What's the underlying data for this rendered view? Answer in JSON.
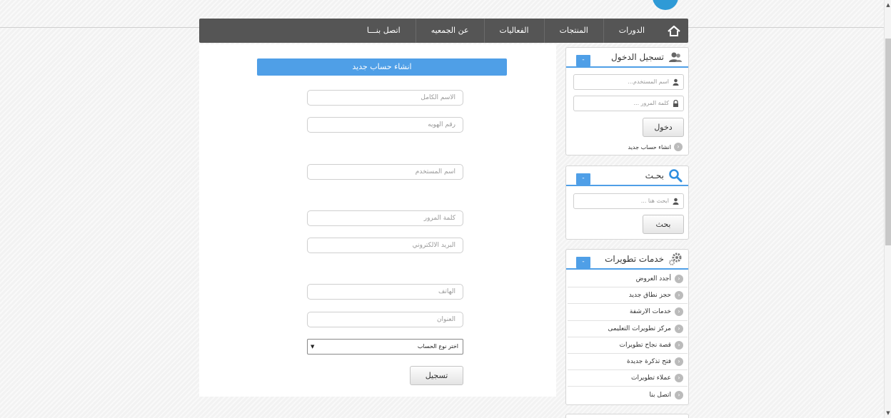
{
  "nav": {
    "items": [
      "الدورات",
      "المنتجات",
      "الفعاليات",
      "عن الجمعيه",
      "اتصل بنـــا"
    ]
  },
  "registration": {
    "title": "انشاء حساب جديد",
    "fields": {
      "full_name": "الاسم الكامل",
      "id_number": "رقم الهويه",
      "username": "اسم المستخدم",
      "password": "كلمة المرور",
      "email": "البريد الالكتروني",
      "phone": "الهاتف",
      "address": "العنوان"
    },
    "account_type": "اختر نوع الحساب",
    "submit_label": "تسجيل"
  },
  "login_panel": {
    "title": "تسجيل الدخول",
    "collapse_label": "-",
    "username_placeholder": "اسم المستخدم...",
    "password_placeholder": "كلمة المرور ...",
    "login_button": "دخول",
    "create_account_link": "انشاء حساب جديد"
  },
  "search_panel": {
    "title": "بحـث",
    "collapse_label": "-",
    "search_placeholder": "ابحث هنا ...",
    "search_button": "بحث"
  },
  "services_panel": {
    "title": "خدمات تطويرات",
    "collapse_label": "-",
    "items": [
      "أجدد العروض",
      "حجز نطاق جديد",
      "خدمات الارشفة",
      "مركز تطويرات التعليمى",
      "قصة نجاح تطويرات",
      "فتح تذكرة جديدة",
      "عملاء تطويرات",
      "اتصل بنا"
    ]
  },
  "colors": {
    "accent": "#4f9fe7",
    "navbar": "#555555",
    "logo": "#2f9ad6"
  }
}
